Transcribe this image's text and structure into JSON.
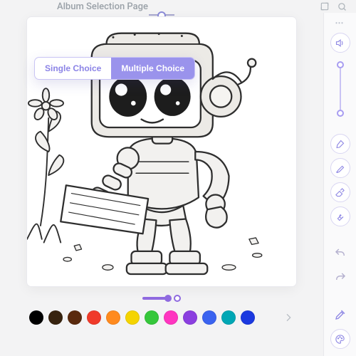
{
  "header": {
    "title": "Album Selection Page"
  },
  "choice": {
    "single_label": "Single Choice",
    "multiple_label": "Multiple Choice",
    "active": "multiple"
  },
  "size_slider": {
    "value": 100,
    "min": 0,
    "max": 100
  },
  "palette": {
    "colors": [
      "#000000",
      "#37230f",
      "#5a2a0e",
      "#f03a2a",
      "#ff8a1e",
      "#f5d400",
      "#35c73b",
      "#ff35c0",
      "#8b3fe0",
      "#3a63f0",
      "#00a7b5",
      "#1b39e0"
    ]
  },
  "tool_slider": {
    "value": 0,
    "min": 0,
    "max": 100
  },
  "rail": {
    "tools": [
      {
        "id": "brush",
        "icon": "brush-icon"
      },
      {
        "id": "tube",
        "icon": "paint-tube-icon"
      },
      {
        "id": "eraser",
        "icon": "eraser-icon"
      },
      {
        "id": "wrench",
        "icon": "wrench-icon"
      }
    ],
    "history": [
      {
        "id": "undo",
        "icon": "undo-icon"
      },
      {
        "id": "redo",
        "icon": "redo-icon"
      }
    ],
    "extras": [
      {
        "id": "eyedropper",
        "icon": "eyedropper-icon"
      },
      {
        "id": "palette",
        "icon": "palette-icon"
      }
    ]
  }
}
